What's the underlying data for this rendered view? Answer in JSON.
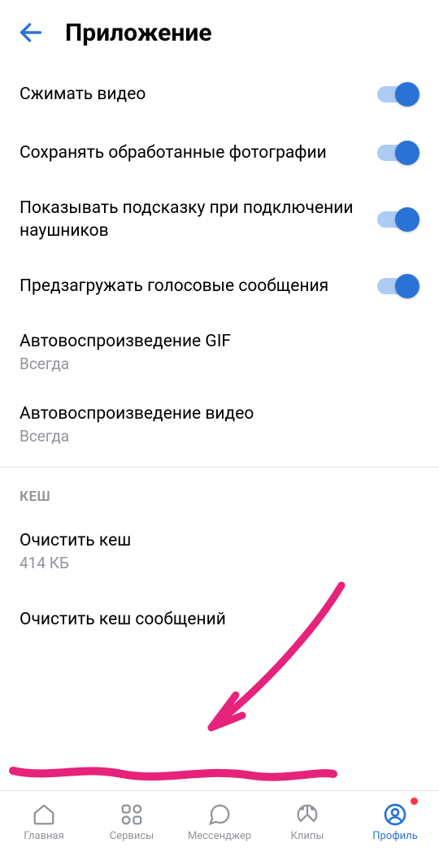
{
  "header": {
    "title": "Приложение"
  },
  "settings": {
    "compress_video": "Сжимать видео",
    "save_processed_photos": "Сохранять обработанные фотографии",
    "headphone_hint": "Показывать подсказку при подключении наушников",
    "preload_voice": "Предзагружать голосовые сообщения",
    "autoplay_gif": {
      "label": "Автовоспроизведение GIF",
      "value": "Всегда"
    },
    "autoplay_video": {
      "label": "Автовоспроизведение видео",
      "value": "Всегда"
    }
  },
  "cache": {
    "section_title": "КЕШ",
    "clear_cache": {
      "label": "Очистить кеш",
      "value": "414 КБ"
    },
    "clear_messages_cache": "Очистить кеш сообщений"
  },
  "nav": {
    "home": "Главная",
    "services": "Сервисы",
    "messenger": "Мессенджер",
    "clips": "Клипы",
    "profile": "Профиль"
  }
}
